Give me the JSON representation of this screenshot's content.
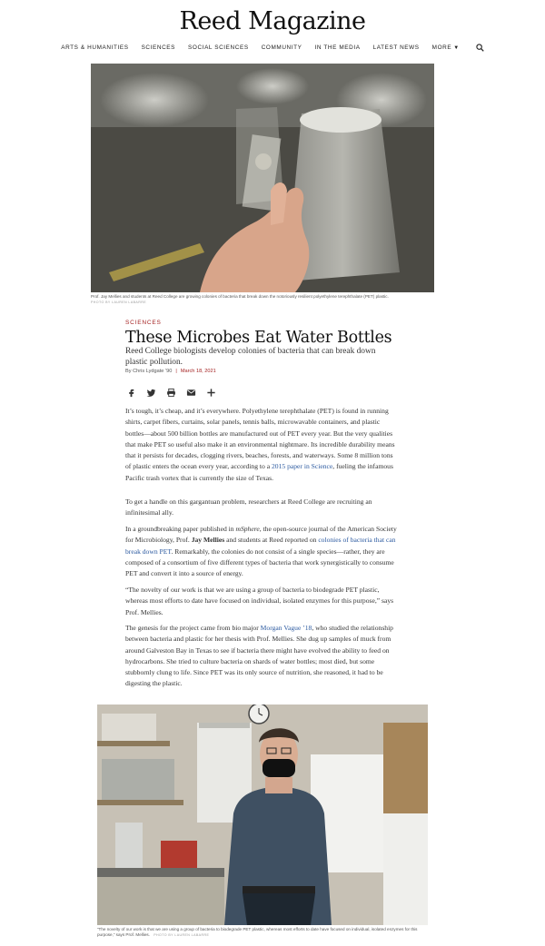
{
  "site": {
    "title": "Reed Magazine"
  },
  "nav": {
    "items": [
      "Arts & Humanities",
      "Sciences",
      "Social Sciences",
      "Community",
      "In the Media",
      "Latest News",
      "More"
    ],
    "search_icon": "search-icon"
  },
  "hero": {
    "caption": "Prof. Jay Mellies and students at Reed College are growing colonies of bacteria that break down the notoriously resilient polyethylene terephthalate (PET) plastic.",
    "credit": "PHOTO BY LAUREN LABARRE"
  },
  "article": {
    "kicker": "Sciences",
    "title": "These Microbes Eat Water Bottles",
    "dek": "Reed College biologists develop colonies of bacteria that can break down plastic pollution.",
    "author": "By Chris Lydgate ’90",
    "separator": "|",
    "date": "March 18, 2021"
  },
  "share": [
    "facebook-icon",
    "twitter-icon",
    "print-icon",
    "email-icon",
    "plus-icon"
  ],
  "body": {
    "p1": "It’s tough, it’s cheap, and it’s everywhere. Polyethylene terephthalate (PET) is found in running shirts, carpet fibers, curtains, solar panels, tennis balls, microwavable containers, and plastic bottles—about 500 billion bottles are manufactured out of PET every year. But the very qualities that make PET so useful also make it an environmental nightmare. Its incredible durability means that it persists for decades, clogging rivers, beaches, forests, and waterways. Some 8 million tons of plastic enters the ocean every year, according to a ",
    "p1_link": "2015 paper in Science",
    "p1_end": ", fueling the infamous Pacific trash vortex that is currently the size of Texas.",
    "p2": "To get a handle on this gargantuan problem, researchers at Reed College are recruiting an infinitesimal ally.",
    "p3_a": "In a groundbreaking paper published in ",
    "p3_journal": "mSphere",
    "p3_b": ", the open-source journal of the American Society for Microbiology, Prof. ",
    "p3_name": "Jay Mellies",
    "p3_c": " and students at Reed reported on ",
    "p3_link": "colonies of bacteria that can break down PET",
    "p3_d": ". Remarkably, the colonies do not consist of a single species—rather, they are composed of a consortium of five different types of bacteria that work synergistically to consume PET and convert it into a source of energy.",
    "p4": "“The novelty of our work is that we are using a group of bacteria to biodegrade PET plastic, whereas most efforts to date have focused on individual, isolated enzymes for this purpose,” says Prof. Mellies.",
    "p5_a": "The genesis for the project came from bio major ",
    "p5_link": "Morgan Vague ’18",
    "p5_b": ", who studied the relationship between bacteria and plastic for her thesis with Prof. Mellies. She dug up samples of muck from around Galveston Bay in Texas to see if bacteria there might have evolved the ability to feed on hydrocarbons. She tried to culture bacteria on shards of water bottles; most died, but some stubbornly clung to life. Since PET was its only source of nutrition, she reasoned, it had to be digesting the plastic."
  },
  "photo2": {
    "caption": "“The novelty of our work is that we are using a group of bacteria to biodegrade PET plastic, whereas most efforts to date have focused on individual, isolated enzymes for this purpose,” says Prof. Mellies.",
    "credit": "PHOTO BY LAUREN LABARRE"
  }
}
